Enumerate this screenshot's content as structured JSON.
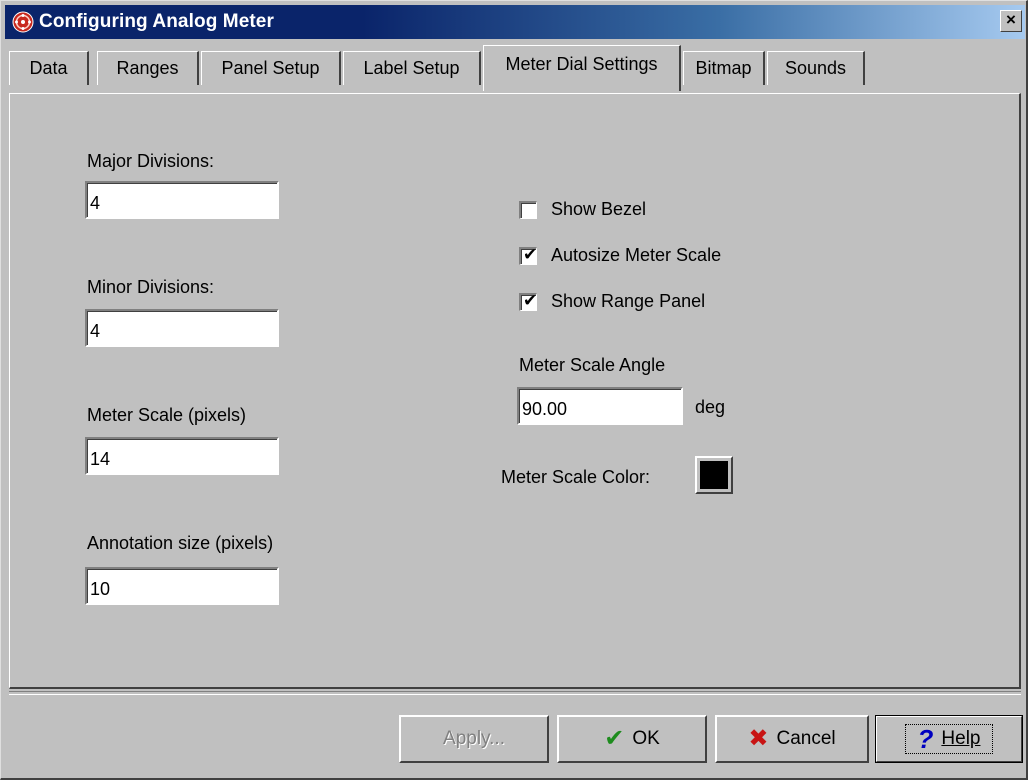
{
  "window": {
    "title": "Configuring Analog Meter",
    "close_glyph": "×",
    "icon": "analog-meter-app-icon"
  },
  "tabs": [
    {
      "label": "Data",
      "active": false
    },
    {
      "label": "Ranges",
      "active": false
    },
    {
      "label": "Panel Setup",
      "active": false
    },
    {
      "label": "Label Setup",
      "active": false
    },
    {
      "label": "Meter Dial Settings",
      "active": true
    },
    {
      "label": "Bitmap",
      "active": false
    },
    {
      "label": "Sounds",
      "active": false
    }
  ],
  "form": {
    "major_divisions": {
      "label": "Major Divisions:",
      "value": "4"
    },
    "minor_divisions": {
      "label": "Minor Divisions:",
      "value": "4"
    },
    "meter_scale": {
      "label": "Meter Scale (pixels)",
      "value": "14"
    },
    "annotation_size": {
      "label": "Annotation size (pixels)",
      "value": "10"
    },
    "show_bezel": {
      "label": "Show Bezel",
      "checked": false
    },
    "autosize_meter_scale": {
      "label": "Autosize Meter Scale",
      "checked": true
    },
    "show_range_panel": {
      "label": "Show Range Panel",
      "checked": true
    },
    "meter_scale_angle": {
      "label": "Meter Scale Angle",
      "value": "90.00",
      "unit": "deg"
    },
    "meter_scale_color": {
      "label": "Meter Scale Color:",
      "color": "#000000"
    }
  },
  "check_glyph": "✔",
  "buttons": {
    "apply": {
      "label": "Apply...",
      "enabled": false
    },
    "ok": {
      "label": "OK",
      "icon": "checkmark-icon",
      "glyph": "✔",
      "icon_color": "#1e8c1e"
    },
    "cancel": {
      "label": "Cancel",
      "icon": "x-icon",
      "glyph": "✖",
      "icon_color": "#c81414"
    },
    "help": {
      "label": "Help",
      "icon": "question-mark-icon",
      "glyph": "?",
      "icon_color": "#0000c0"
    }
  }
}
